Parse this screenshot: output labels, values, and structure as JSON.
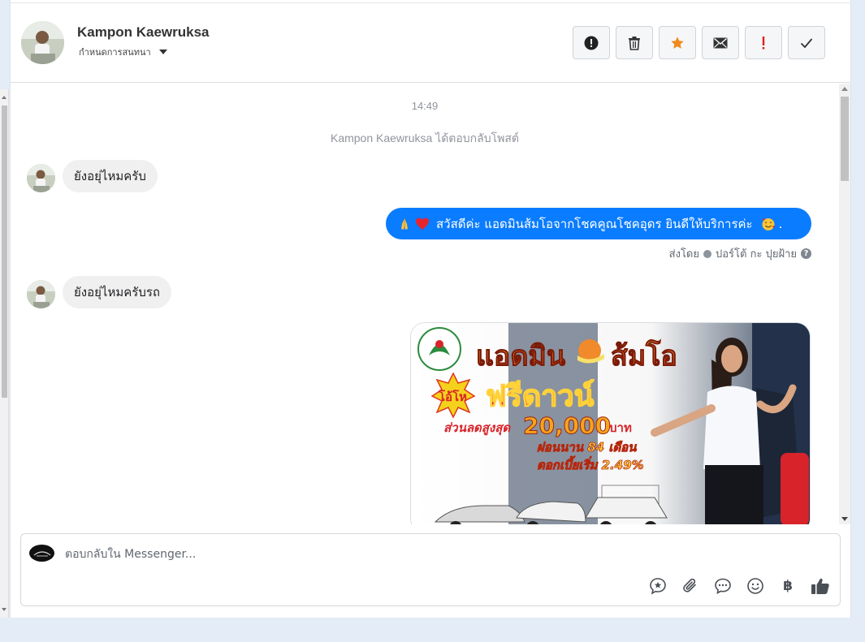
{
  "header": {
    "contact_name": "Kampon Kaewruksa",
    "assign_label": "กำหนดการสนทนา",
    "actions": [
      {
        "name": "report-spam",
        "icon": "exclamation-circle-icon"
      },
      {
        "name": "delete",
        "icon": "trash-icon"
      },
      {
        "name": "star",
        "icon": "star-icon",
        "color": "#f28a1c"
      },
      {
        "name": "mark-unread",
        "icon": "envelope-icon"
      },
      {
        "name": "follow-up",
        "icon": "exclamation-icon",
        "color": "#e02020"
      },
      {
        "name": "mark-done",
        "icon": "checkmark-icon"
      }
    ]
  },
  "chat": {
    "timestamp": "14:49",
    "system_note": "Kampon Kaewruksa ได้ตอบกลับโพสต์",
    "messages": [
      {
        "direction": "incoming",
        "text": "ยังอยุ่ไหมครับ"
      },
      {
        "direction": "outgoing",
        "text": "สวัสดีค่ะ แอดมินส้มโอจากโชคคูณโชคอุดร ยินดีให้บริการค่ะ",
        "suffix": "."
      },
      {
        "direction": "incoming",
        "text": "ยังอยุ่ไหมครับรถ"
      }
    ],
    "sent_by_prefix": "ส่งโดย",
    "sent_by_name": "ปอร์โต้ กะ ปุยฝ้าย",
    "promo": {
      "headline_1": "แอดมิน",
      "headline_2": "ส้มโอ",
      "badge": "โอ้โห",
      "free_down": "ฟรีดาวน์",
      "discount_label": "ส่วนลดสูงสุด",
      "discount_value": "20,000",
      "discount_unit": "บาท",
      "installment": "ผ่อนนาน 84 เดือน",
      "interest": "ดอกเบี้ยเริ่ม 2.49%"
    }
  },
  "composer": {
    "placeholder": "ตอบกลับใน Messenger...",
    "tools": [
      "saved-reply-icon",
      "attachment-icon",
      "chat-bubble-icon",
      "smiley-icon",
      "baht-icon",
      "thumbs-up-icon"
    ],
    "baht_symbol": "฿"
  },
  "colors": {
    "outgoing_bubble": "#0a7cff",
    "incoming_bubble": "#f1f0f0",
    "star": "#f28a1c",
    "alert": "#e02020"
  }
}
